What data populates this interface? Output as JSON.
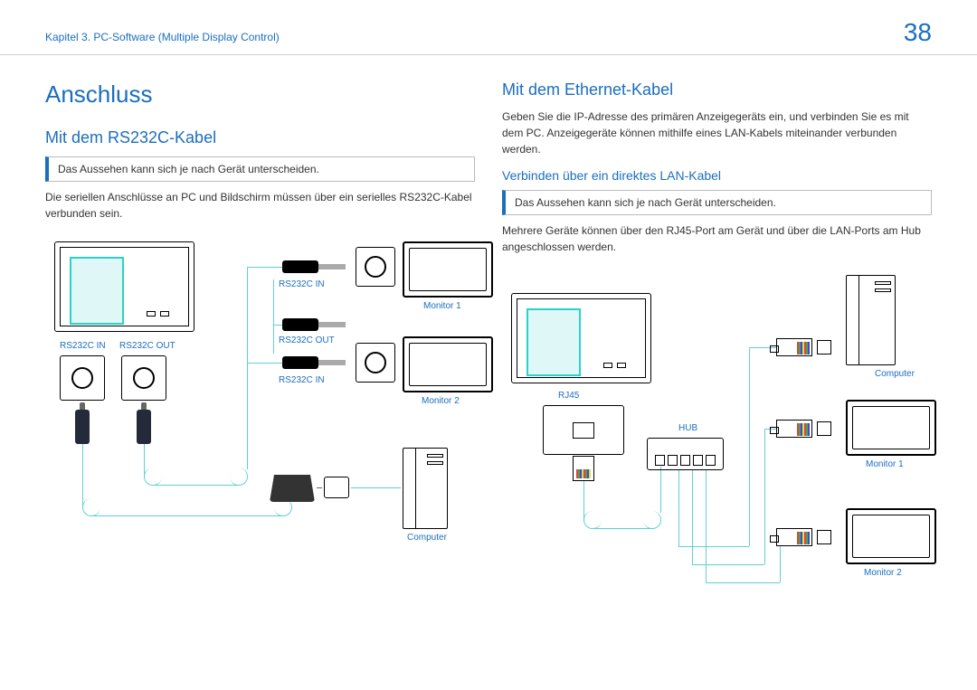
{
  "header": {
    "chapter": "Kapitel 3. PC-Software (Multiple Display Control)",
    "page_number": "38"
  },
  "left": {
    "h1": "Anschluss",
    "h2": "Mit dem RS232C-Kabel",
    "note": "Das Aussehen kann sich je nach Gerät unterscheiden.",
    "body": "Die seriellen Anschlüsse an PC und Bildschirm müssen über ein serielles RS232C-Kabel verbunden sein.",
    "labels": {
      "rs232c_in_left": "RS232C IN",
      "rs232c_out_left": "RS232C OUT",
      "rs232c_in_top": "RS232C IN",
      "rs232c_out_mid": "RS232C OUT",
      "rs232c_in_bottom": "RS232C IN",
      "monitor1": "Monitor 1",
      "monitor2": "Monitor 2",
      "computer": "Computer"
    }
  },
  "right": {
    "h2": "Mit dem Ethernet-Kabel",
    "body1": "Geben Sie die IP-Adresse des primären Anzeigegeräts ein, und verbinden Sie es mit dem PC. Anzeigegeräte können mithilfe eines LAN-Kabels miteinander verbunden werden.",
    "h3": "Verbinden über ein direktes LAN-Kabel",
    "note": "Das Aussehen kann sich je nach Gerät unterscheiden.",
    "body2": "Mehrere Geräte können über den RJ45-Port am Gerät und über die LAN-Ports am Hub angeschlossen werden.",
    "labels": {
      "rj45": "RJ45",
      "hub": "HUB",
      "computer": "Computer",
      "monitor1": "Monitor 1",
      "monitor2": "Monitor 2"
    }
  }
}
